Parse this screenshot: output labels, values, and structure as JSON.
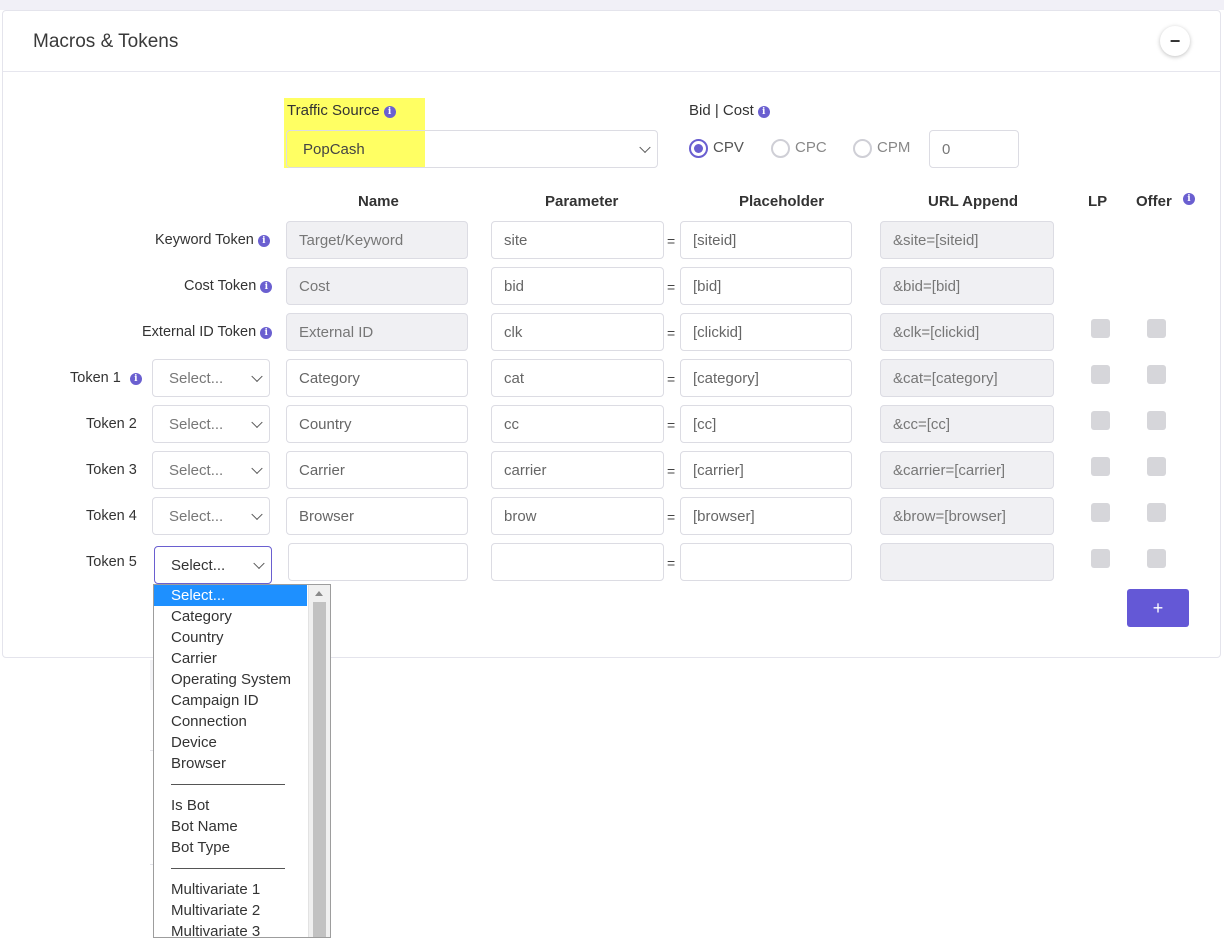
{
  "panel": {
    "title": "Macros & Tokens",
    "collapse_symbol": "−"
  },
  "traffic_source": {
    "label": "Traffic Source",
    "value": "PopCash"
  },
  "bid_cost": {
    "label": "Bid | Cost",
    "options": [
      "CPV",
      "CPC",
      "CPM"
    ],
    "selected": "CPV",
    "amount": "0"
  },
  "columns": {
    "name": "Name",
    "parameter": "Parameter",
    "placeholder": "Placeholder",
    "url_append": "URL Append",
    "lp": "LP",
    "offer": "Offer"
  },
  "rows": [
    {
      "label": "Keyword Token",
      "select": "",
      "name": "Target/Keyword",
      "parameter": "site",
      "placeholder": "[siteid]",
      "url_append": "&site=[siteid]"
    },
    {
      "label": "Cost Token",
      "select": "",
      "name": "Cost",
      "parameter": "bid",
      "placeholder": "[bid]",
      "url_append": "&bid=[bid]"
    },
    {
      "label": "External ID Token",
      "select": "",
      "name": "External ID",
      "parameter": "clk",
      "placeholder": "[clickid]",
      "url_append": "&clk=[clickid]"
    },
    {
      "label": "Token 1",
      "select": "Select...",
      "name": "Category",
      "parameter": "cat",
      "placeholder": "[category]",
      "url_append": "&cat=[category]"
    },
    {
      "label": "Token 2",
      "select": "Select...",
      "name": "Country",
      "parameter": "cc",
      "placeholder": "[cc]",
      "url_append": "&cc=[cc]"
    },
    {
      "label": "Token 3",
      "select": "Select...",
      "name": "Carrier",
      "parameter": "carrier",
      "placeholder": "[carrier]",
      "url_append": "&carrier=[carrier]"
    },
    {
      "label": "Token 4",
      "select": "Select...",
      "name": "Browser",
      "parameter": "brow",
      "placeholder": "[browser]",
      "url_append": "&brow=[browser]"
    },
    {
      "label": "Token 5",
      "select": "Select...",
      "name": "",
      "parameter": "",
      "placeholder": "",
      "url_append": ""
    }
  ],
  "equals_sign": "=",
  "add_button": "+",
  "dropdown": {
    "items": [
      "Select...",
      "Category",
      "Country",
      "Carrier",
      "Operating System",
      "Campaign ID",
      "Connection",
      "Device",
      "Browser",
      "---",
      "Is Bot",
      "Bot Name",
      "Bot Type",
      "---",
      "Multivariate 1",
      "Multivariate 2",
      "Multivariate 3"
    ],
    "selected": "Select..."
  },
  "colors": {
    "accent": "#6a5fd0",
    "highlight": "#ffff63",
    "dropdown_selected": "#1e90ff"
  }
}
